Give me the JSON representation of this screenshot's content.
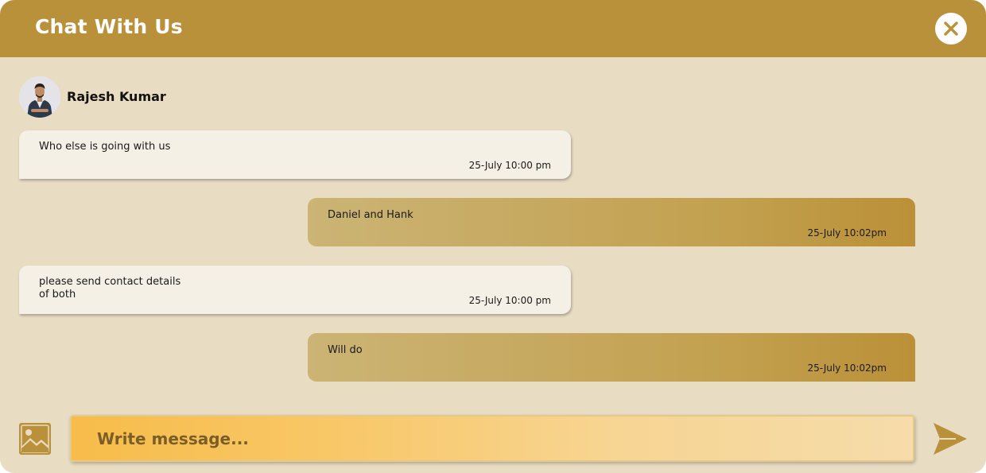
{
  "header": {
    "title": "Chat With Us",
    "close_icon": "close-icon"
  },
  "contact": {
    "name": "Rajesh Kumar",
    "avatar_icon": "avatar"
  },
  "messages": [
    {
      "direction": "incoming",
      "text": "Who else is going with us",
      "time": "25-July 10:00 pm"
    },
    {
      "direction": "outgoing",
      "text": "Daniel and Hank",
      "time": "25-July 10:02pm"
    },
    {
      "direction": "incoming",
      "text": "please send contact details\nof both",
      "time": "25-July 10:00 pm"
    },
    {
      "direction": "outgoing",
      "text": "Will do",
      "time": "25-July 10:02pm"
    }
  ],
  "composer": {
    "placeholder": "Write message...",
    "value": "",
    "attach_icon": "image-icon",
    "send_icon": "send-icon"
  },
  "colors": {
    "header": "#b9913a",
    "background": "#e8dcc2",
    "incoming_bubble": "#f4f0e6",
    "outgoing_bubble": "#c2a04e",
    "input": "#f8c766"
  }
}
